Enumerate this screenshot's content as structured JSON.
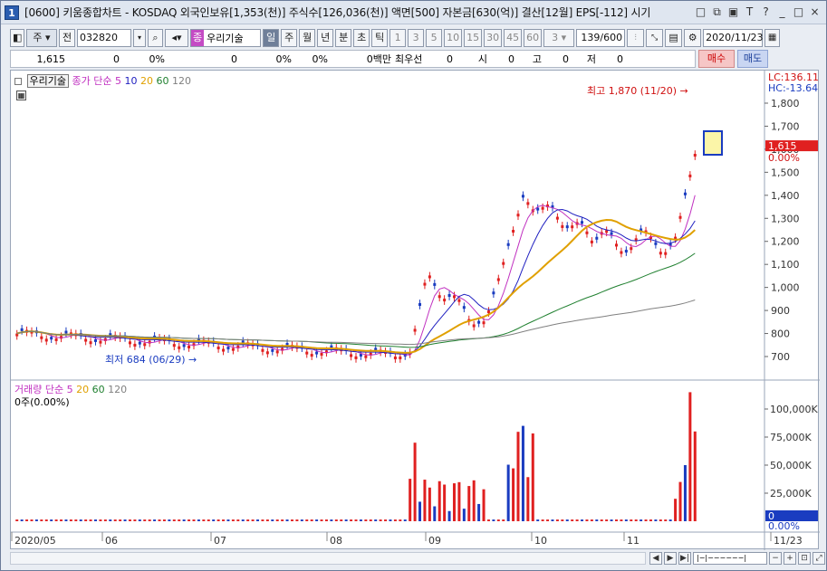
{
  "window": {
    "number": "1",
    "title": "[0600] 키움종합차트 - KOSDAQ 외국인보유[1,353(천)] 주식수[126,036(천)] 액면[500] 자본금[630(억)] 결산[12월] EPS[-112] 시기",
    "controls": [
      "□",
      "⧉",
      "▣",
      "T",
      "?",
      "_",
      "□",
      "×"
    ]
  },
  "toolbar": {
    "period_label": "주",
    "prev_label": "전",
    "stock_code": "032820",
    "stock_badge": "종",
    "stock_name": "우리기술",
    "tabs": [
      "일",
      "주",
      "월",
      "년",
      "분",
      "초",
      "틱"
    ],
    "intervals": [
      "1",
      "3",
      "5",
      "10",
      "15",
      "30",
      "45",
      "60"
    ],
    "interval_select": "3",
    "count": "139/600",
    "date": "2020/11/23"
  },
  "infobar": {
    "price": "1,615",
    "v1": "0",
    "v2": "0%",
    "v3": "0",
    "v4": "0%",
    "v5": "0%",
    "volume": "0백만",
    "ask_label": "최우선",
    "v6": "0",
    "open_label": "시",
    "open": "0",
    "high_label": "고",
    "high": "0",
    "low_label": "저",
    "low": "0",
    "buy_label": "매수",
    "sell_label": "매도"
  },
  "price_legend": {
    "stock": "우리기술",
    "label": "종가 단순",
    "ma": [
      "5",
      "10",
      "20",
      "60",
      "120"
    ]
  },
  "volume_legend": {
    "label": "거래량 단순",
    "ma": [
      "5",
      "20",
      "60",
      "120"
    ],
    "value": "0주(0.00%)"
  },
  "annotations": {
    "high": "최고 1,870 (11/20)",
    "low": "최저 684 (06/29)"
  },
  "right_axis": {
    "lc": "LC:136.11",
    "hc": "HC:-13.64",
    "price_ticks": [
      "1,800",
      "1,700",
      "1,600",
      "1,500",
      "1,400",
      "1,300",
      "1,200",
      "1,100",
      "1,000",
      "900",
      "800",
      "700"
    ],
    "current_price": "1,615",
    "current_pct": "0.00%",
    "volume_ticks": [
      "100,000K",
      "75,000K",
      "50,000K",
      "25,000K"
    ],
    "current_volume": "0",
    "current_volume_pct": "0.00%"
  },
  "x_axis": {
    "labels": [
      "2020/05",
      "06",
      "07",
      "08",
      "09",
      "10",
      "11",
      "11/23"
    ]
  },
  "colors": {
    "up": "#e02020",
    "down": "#1a3cc0",
    "ma5": "#c030c0",
    "ma10": "#2020c0",
    "ma20": "#e0a000",
    "ma60": "#208030",
    "ma120": "#808080"
  }
}
